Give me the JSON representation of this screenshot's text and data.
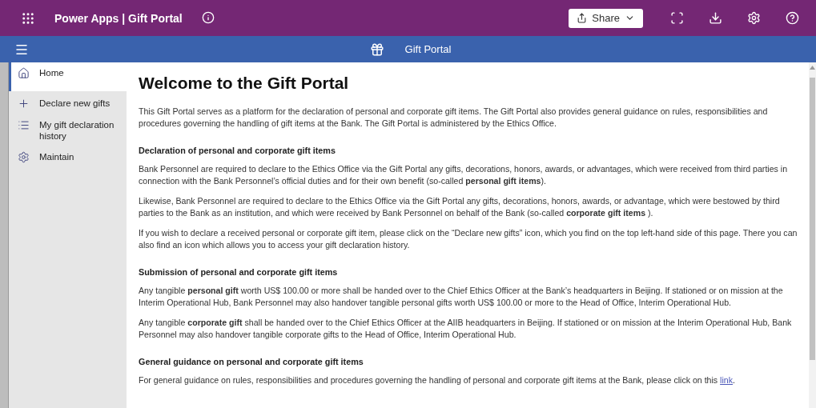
{
  "app_bar": {
    "title": "Power Apps | Gift Portal",
    "share_button": "Share"
  },
  "header": {
    "title": "Gift Portal"
  },
  "sidebar": {
    "items": [
      {
        "label": "Home",
        "selected": true
      },
      {
        "label": "Declare new gifts",
        "selected": false
      },
      {
        "label": "My gift declaration history",
        "selected": false
      },
      {
        "label": "Maintain",
        "selected": false
      }
    ]
  },
  "content": {
    "title": "Welcome to the Gift Portal",
    "intro": "This Gift Portal serves as a platform for the declaration of personal and corporate gift items. The Gift Portal also provides general guidance on rules, responsibilities and procedures governing the handling of gift items at the Bank. The Gift Portal is administered by the Ethics Office.",
    "sections": [
      {
        "heading": "Declaration of personal and corporate gift items",
        "paragraphs": [
          {
            "text": "Bank Personnel are required to declare to the Ethics Office via the Gift Portal any gifts, decorations, honors, awards, or advantages, which were received from third parties in connection with the Bank Personnel’s official duties and for their own benefit (so-called **personal gift items**)."
          },
          {
            "text": "Likewise, Bank Personnel are required to declare to the Ethics Office via the Gift Portal any gifts, decorations, honors, awards, or advantage, which were bestowed by third parties to the Bank as an institution, and which were received by Bank Personnel on behalf of the Bank (so-called **corporate gift items** )."
          },
          {
            "text": "If you wish to declare a received personal or corporate gift item, please click on the “Declare new gifts” icon, which you find on the top left-hand side of this page. There you can also find an icon which allows you to access your gift declaration history."
          }
        ]
      },
      {
        "heading": "Submission of personal and corporate gift items",
        "paragraphs": [
          {
            "text": "Any tangible **personal gift** worth US$ 100.00 or more shall be handed over to the Chief Ethics Officer at the Bank’s headquarters in Beijing. If stationed or on mission at the Interim Operational Hub, Bank Personnel may also handover tangible personal gifts worth US$ 100.00 or more to the Head of Office, Interim Operational Hub."
          },
          {
            "text": "Any tangible **corporate gift** shall be handed over to the Chief Ethics Officer at the AIIB headquarters in Beijing. If stationed or on mission at the Interim Operational Hub, Bank Personnel may also handover tangible corporate gifts to the Head of Office, Interim Operational Hub."
          }
        ]
      },
      {
        "heading": "General guidance on personal and corporate gift items",
        "paragraphs": [
          {
            "text": "For general guidance on rules, responsibilities and procedures governing the handling of personal and corporate gift items at the Bank, please click on this ",
            "link": "link",
            "after": "."
          }
        ]
      }
    ]
  }
}
